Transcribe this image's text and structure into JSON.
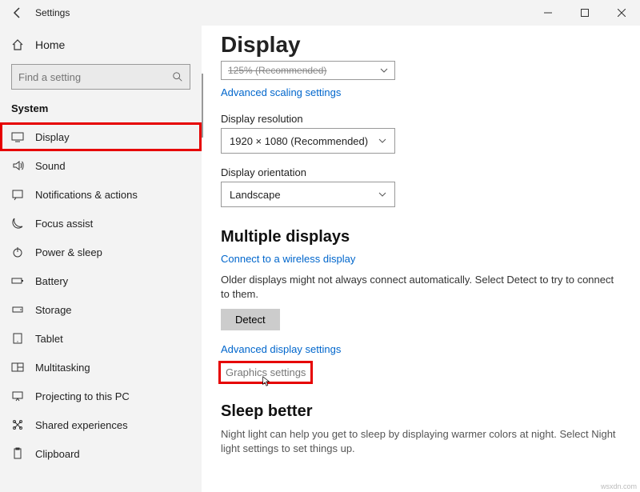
{
  "titlebar": {
    "title": "Settings"
  },
  "sidebar": {
    "home": "Home",
    "search_placeholder": "Find a setting",
    "section": "System",
    "items": [
      {
        "label": "Display"
      },
      {
        "label": "Sound"
      },
      {
        "label": "Notifications & actions"
      },
      {
        "label": "Focus assist"
      },
      {
        "label": "Power & sleep"
      },
      {
        "label": "Battery"
      },
      {
        "label": "Storage"
      },
      {
        "label": "Tablet"
      },
      {
        "label": "Multitasking"
      },
      {
        "label": "Projecting to this PC"
      },
      {
        "label": "Shared experiences"
      },
      {
        "label": "Clipboard"
      }
    ]
  },
  "content": {
    "title": "Display",
    "scaling_value": "125% (Recommended)",
    "adv_scaling": "Advanced scaling settings",
    "resolution_label": "Display resolution",
    "resolution_value": "1920 × 1080 (Recommended)",
    "orientation_label": "Display orientation",
    "orientation_value": "Landscape",
    "multi_title": "Multiple displays",
    "connect_link": "Connect to a wireless display",
    "older_text": "Older displays might not always connect automatically. Select Detect to try to connect to them.",
    "detect_btn": "Detect",
    "adv_display": "Advanced display settings",
    "graphics": "Graphics settings",
    "sleep_title": "Sleep better",
    "sleep_text": "Night light can help you get to sleep by displaying warmer colors at night. Select Night light settings to set things up."
  },
  "watermark": "wsxdn.com"
}
